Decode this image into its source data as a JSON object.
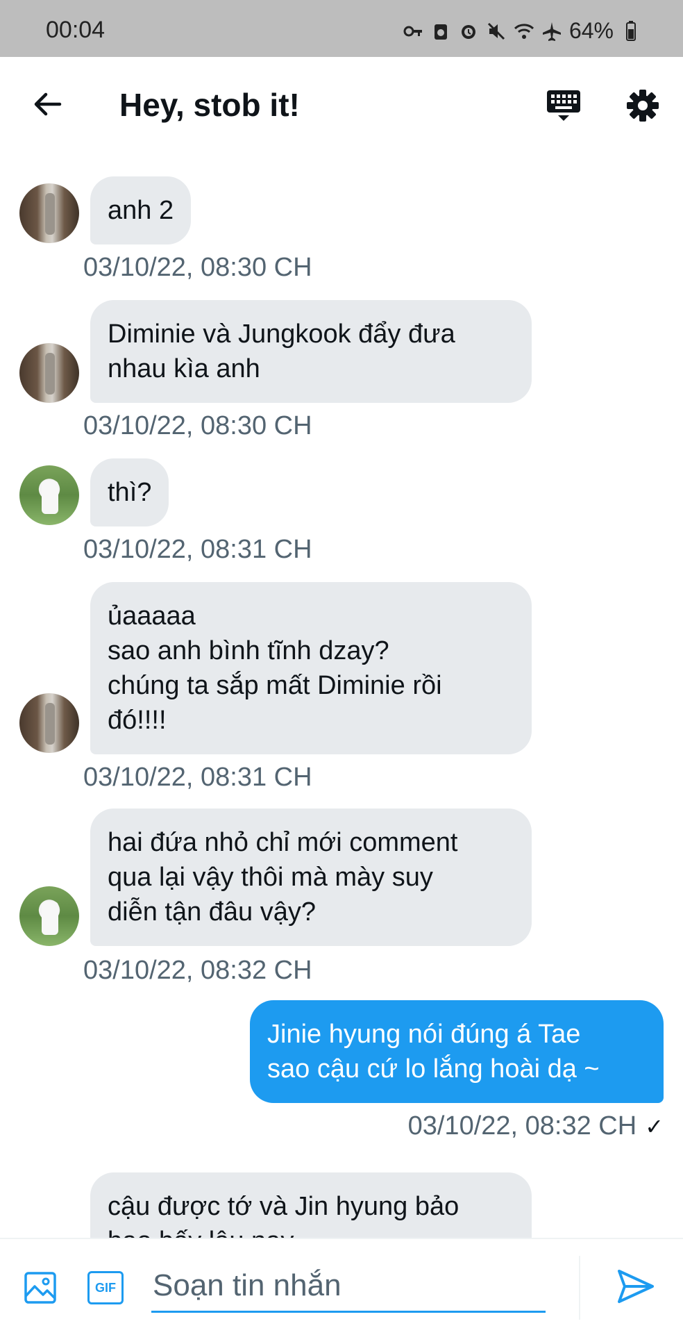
{
  "status_bar": {
    "time": "00:04",
    "battery": "64%",
    "icons": [
      "key-icon",
      "cloud-sync-icon",
      "alarm-icon",
      "mute-icon",
      "wifi-icon",
      "airplane-icon",
      "battery-icon"
    ]
  },
  "header": {
    "title": "Hey, stob it!",
    "back_icon": "back-arrow-icon",
    "keyboard_icon": "keyboard-icon",
    "settings_icon": "gear-icon"
  },
  "messages": [
    {
      "sender": "other",
      "avatar": "avatar-a",
      "text": "anh 2",
      "timestamp": "03/10/22, 08:30 CH"
    },
    {
      "sender": "other",
      "avatar": "avatar-a",
      "text": "Diminie và Jungkook đẩy đưa\nnhau kìa anh",
      "timestamp": "03/10/22, 08:30 CH"
    },
    {
      "sender": "other",
      "avatar": "avatar-b",
      "text": "thì?",
      "timestamp": "03/10/22, 08:31 CH"
    },
    {
      "sender": "other",
      "avatar": "avatar-a",
      "text": "ủaaaaa\nsao anh bình tĩnh dzay?\nchúng ta sắp mất Diminie rồi\nđó!!!!",
      "timestamp": "03/10/22, 08:31 CH"
    },
    {
      "sender": "other",
      "avatar": "avatar-b",
      "text": "hai đứa nhỏ chỉ mới comment\nqua lại vậy thôi mà mày suy\ndiễn tận đâu vậy?",
      "timestamp": "03/10/22, 08:32 CH"
    },
    {
      "sender": "me",
      "text": "Jinie hyung nói đúng á Tae\nsao cậu cứ lo lắng hoài dạ ~",
      "timestamp": "03/10/22, 08:32 CH",
      "status": "✓"
    },
    {
      "sender": "other",
      "text": "cậu được tớ và Jin hyung bảo\nbao bấy lâu nay"
    }
  ],
  "composer": {
    "placeholder": "Soạn tin nhắn",
    "value": "",
    "gif_label": "GIF",
    "media_icon": "image-icon",
    "send_icon": "send-icon"
  },
  "colors": {
    "accent": "#1d9bf0",
    "bubble_other": "#e7eaed",
    "timestamp": "#536471",
    "status_bar": "#bdbdbd"
  }
}
